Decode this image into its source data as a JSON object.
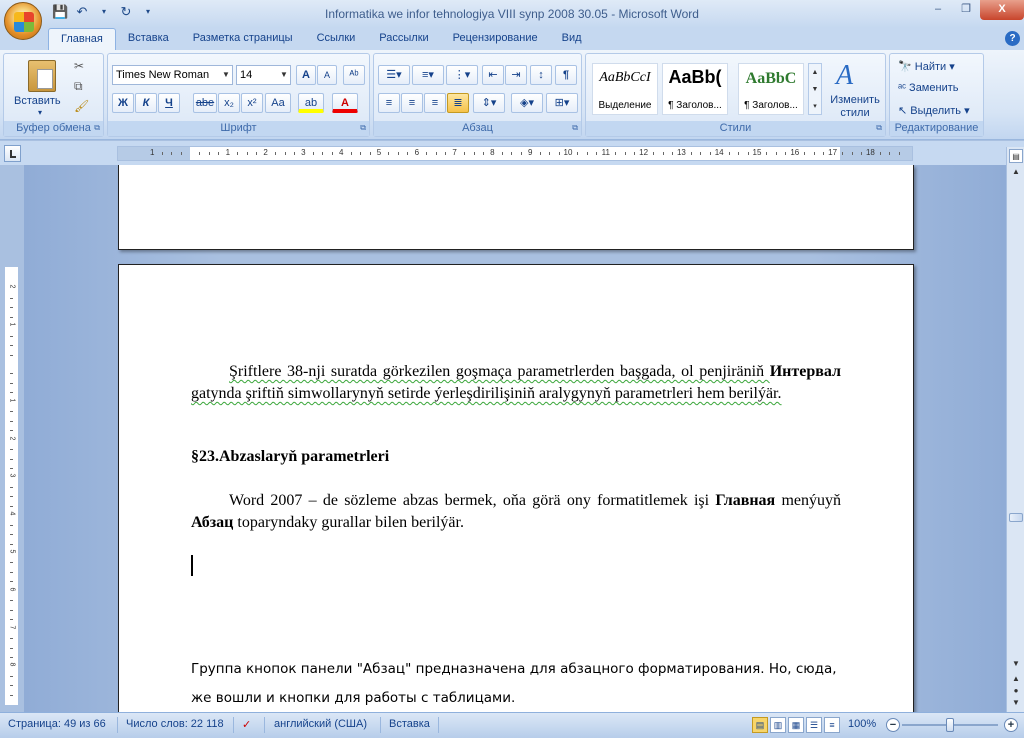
{
  "window": {
    "title": "Informatika we infor tehnologiya VIII synp 2008 30.05 - Microsoft Word",
    "minimize": "–",
    "restore": "❐",
    "close": "X"
  },
  "quick_access": {
    "save_icon": "save-icon",
    "undo_icon": "undo-icon",
    "redo_icon": "redo-icon"
  },
  "tabs": [
    "Главная",
    "Вставка",
    "Разметка страницы",
    "Ссылки",
    "Рассылки",
    "Рецензирование",
    "Вид"
  ],
  "ribbon": {
    "clipboard": {
      "label": "Буфер обмена",
      "paste": "Вставить"
    },
    "font": {
      "label": "Шрифт",
      "font_name": "Times New Roman",
      "font_size": "14",
      "grow": "A",
      "shrink": "A",
      "bold": "Ж",
      "italic": "К",
      "underline": "Ч",
      "strike": "abe",
      "sub": "x₂",
      "sup": "x²",
      "case": "Aa",
      "highlight": "ab",
      "color": "A"
    },
    "paragraph": {
      "label": "Абзац",
      "pilcrow": "¶"
    },
    "styles": {
      "label": "Стили",
      "items": [
        {
          "sample": "AaBbCcI",
          "name": "Выделение"
        },
        {
          "sample": "AaBb(",
          "name": "¶ Заголов..."
        },
        {
          "sample": "AaBbC",
          "name": "¶ Заголов..."
        }
      ],
      "change_styles_line1": "Изменить",
      "change_styles_line2": "стили"
    },
    "editing": {
      "label": "Редактирование",
      "find": "Найти",
      "replace": "Заменить",
      "select": "Выделить"
    }
  },
  "document": {
    "para1_start": "Şriftlere 38-nji suratda görkezilen goşmaça parametrlerden başgada, ol penjiräniň ",
    "para1_bold": "Интервал",
    "para1_end": " gatynda şriftiň simwollarynyň setirde ýerleşdirilişiniň aralygynyň parametrleri hem berilýär.",
    "heading": "§23.Abzaslaryň parametrleri",
    "para2_start": "Word 2007 – de  sözleme abzas bermek, oňa görä ony formatitlemek işi ",
    "para2_bold1": "Главная",
    "para2_mid": " menýuyň ",
    "para2_bold2": "Абзац",
    "para2_end": " toparyndaky gurallar bilen berilýär.",
    "note": "Группа кнопок панели \"Абзац\" предназначена для абзацного форматирования. Но, сюда, же вошли и кнопки для работы с таблицами."
  },
  "status": {
    "page": "Страница: 49 из 66",
    "words": "Число слов: 22 118",
    "language": "английский (США)",
    "mode": "Вставка",
    "zoom": "100%"
  }
}
